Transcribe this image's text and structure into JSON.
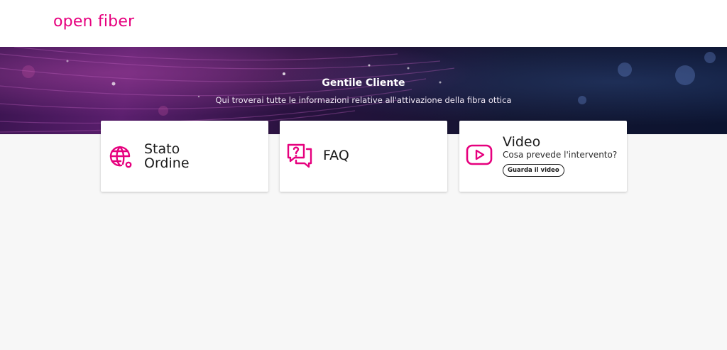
{
  "header": {
    "logo_text": "open fiber"
  },
  "hero": {
    "title": "Gentile Cliente",
    "subtitle": "Qui troverai tutte le informazioni relative all'attivazione della fibra ottica"
  },
  "cards": {
    "order_status": {
      "title_line1": "Stato",
      "title_line2": "Ordine",
      "icon": "globe-icon"
    },
    "faq": {
      "title": "FAQ",
      "icon": "question-chat-icon"
    },
    "video": {
      "title": "Video",
      "subtitle": "Cosa prevede l'intervento?",
      "button_label": "Guarda il video",
      "icon": "play-icon"
    }
  },
  "colors": {
    "brand": "#e6007e",
    "page_bg": "#f7f7f7",
    "text": "#1c1c1c"
  }
}
